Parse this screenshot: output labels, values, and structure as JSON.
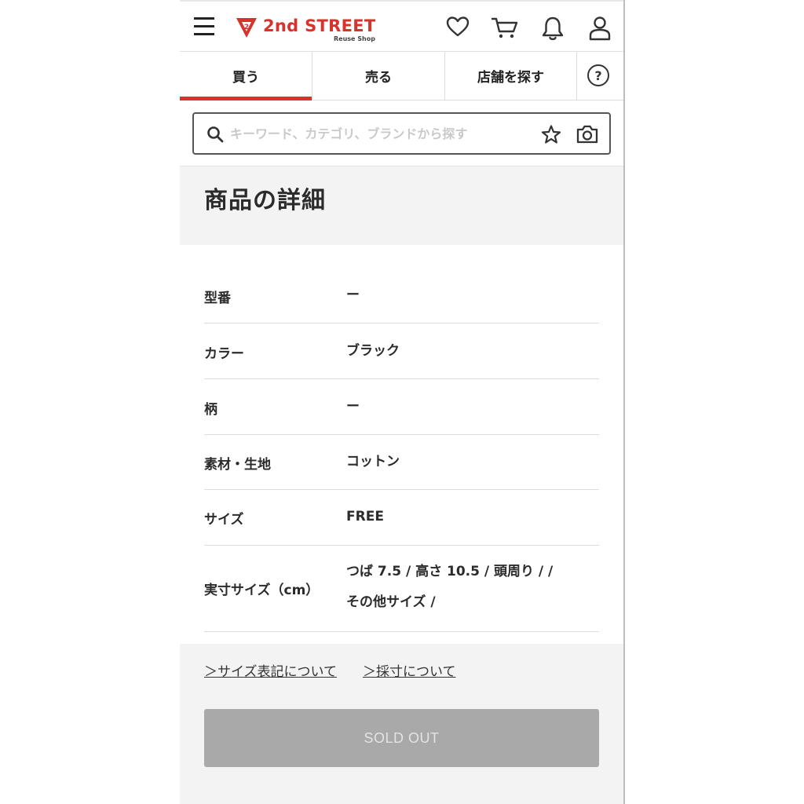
{
  "header": {
    "logo_text": "2nd STREET",
    "logo_sub": "Reuse Shop",
    "icons": [
      "menu-icon",
      "heart-icon",
      "cart-icon",
      "bell-icon",
      "user-icon"
    ]
  },
  "nav": {
    "tabs": [
      {
        "label": "買う",
        "active": true
      },
      {
        "label": "売る",
        "active": false
      },
      {
        "label": "店舗を探す",
        "active": false
      }
    ],
    "help_label": "?"
  },
  "search": {
    "placeholder": "キーワード、カテゴリ、ブランドから探す",
    "value": ""
  },
  "page_title": "商品の詳細",
  "specs": [
    {
      "label": "型番",
      "value": "ー"
    },
    {
      "label": "カラー",
      "value": "ブラック"
    },
    {
      "label": "柄",
      "value": "ー"
    },
    {
      "label": "素材・生地",
      "value": "コットン"
    },
    {
      "label": "サイズ",
      "value": "FREE"
    },
    {
      "label": "実寸サイズ（cm）",
      "value_line1": "つば 7.5 / 高さ 10.5 / 頭周り / /",
      "value_line2": "その他サイズ /"
    }
  ],
  "links": {
    "size_notation": "＞サイズ表記について",
    "measurement": "＞採寸について"
  },
  "sold_out_label": "SOLD OUT",
  "colors": {
    "brand_red": "#d7322b",
    "sold_out_bg": "#a9a9a9",
    "band_bg": "#f3f3f3"
  }
}
